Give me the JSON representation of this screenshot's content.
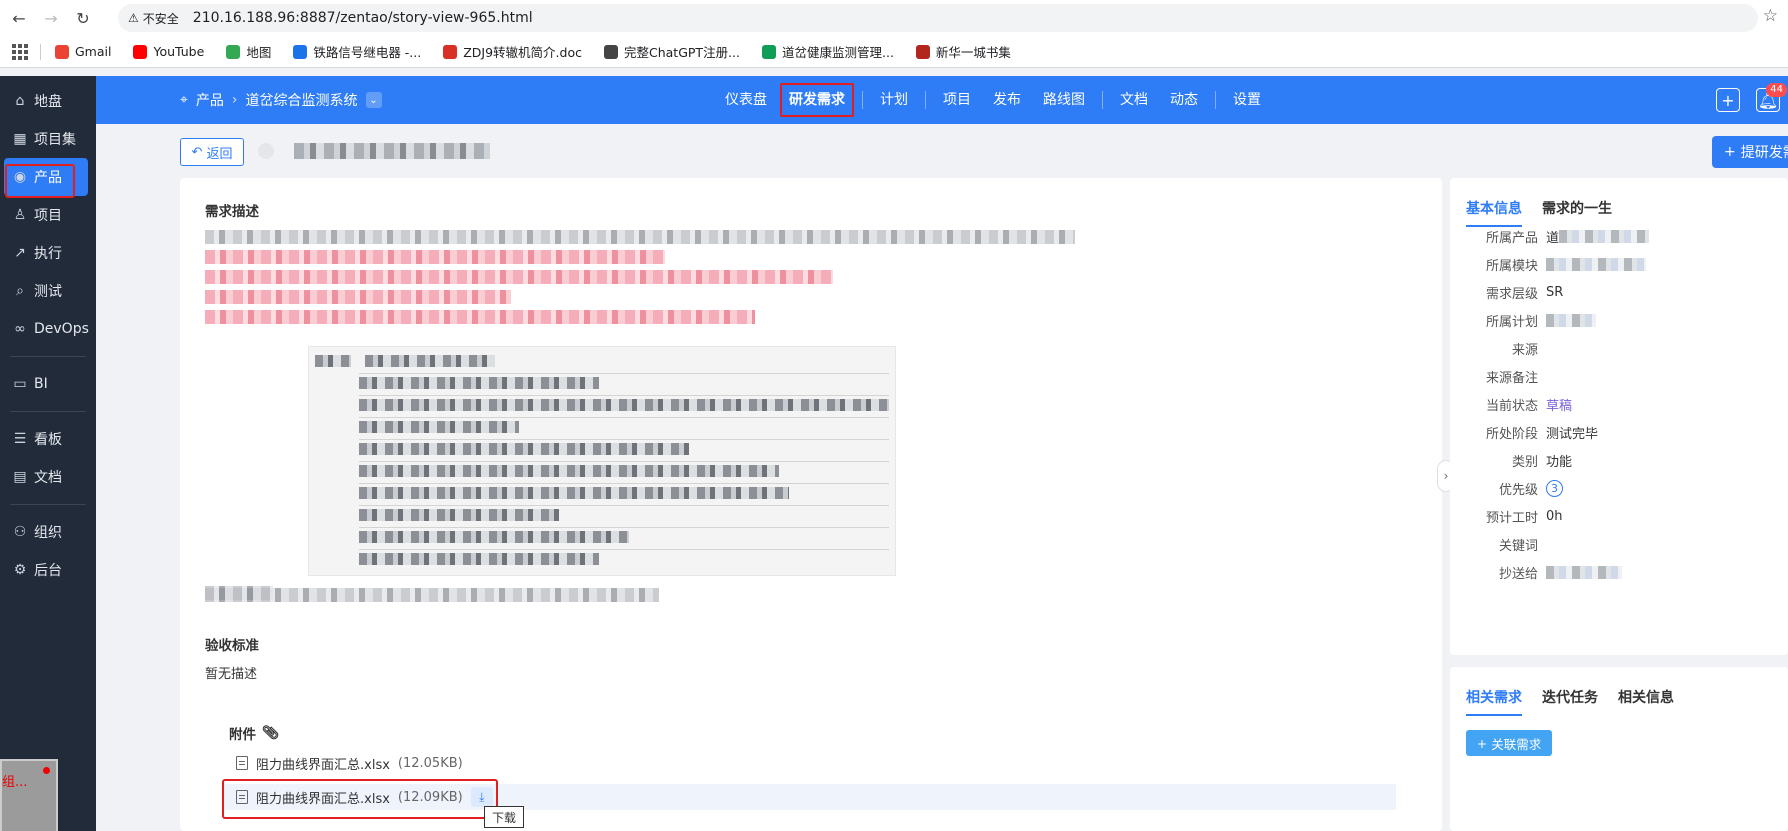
{
  "browser": {
    "insecure_label": "不安全",
    "url": "210.16.188.96:8887/zentao/story-view-965.html",
    "bookmarks": [
      {
        "label": "Gmail",
        "color": "#ea4335"
      },
      {
        "label": "YouTube",
        "color": "#ff0000"
      },
      {
        "label": "地图",
        "color": "#34a853"
      },
      {
        "label": "铁路信号继电器 -...",
        "color": "#1a73e8"
      },
      {
        "label": "ZDJ9转辙机简介.doc",
        "color": "#d93025"
      },
      {
        "label": "完整ChatGPT注册...",
        "color": "#444444"
      },
      {
        "label": "道岔健康监测管理...",
        "color": "#0f9d58"
      },
      {
        "label": "新华一城书集",
        "color": "#b3261e"
      }
    ]
  },
  "sidebar": {
    "items": [
      {
        "label": "地盘",
        "icon": "home-icon"
      },
      {
        "label": "项目集",
        "icon": "grid-icon"
      },
      {
        "label": "产品",
        "icon": "product-icon"
      },
      {
        "label": "项目",
        "icon": "project-icon"
      },
      {
        "label": "执行",
        "icon": "run-icon"
      },
      {
        "label": "测试",
        "icon": "search-icon"
      },
      {
        "label": "DevOps",
        "icon": "infinity-icon"
      },
      {
        "label": "BI",
        "icon": "bi-icon"
      },
      {
        "label": "看板",
        "icon": "kanban-icon"
      },
      {
        "label": "文档",
        "icon": "doc-icon"
      },
      {
        "label": "组织",
        "icon": "org-icon"
      },
      {
        "label": "后台",
        "icon": "gear-icon"
      }
    ],
    "thumb_label": "组..."
  },
  "header": {
    "crumb_root": "产品",
    "crumb_product": "道岔综合监测系统",
    "nav": [
      "仪表盘",
      "研发需求",
      "计划",
      "项目",
      "发布",
      "路线图",
      "文档",
      "动态",
      "设置"
    ],
    "active_nav": "研发需求",
    "badge": "44"
  },
  "toolbar": {
    "back_label": "返回",
    "new_label": "提研发需"
  },
  "main": {
    "desc_title": "需求描述",
    "accept_title": "验收标准",
    "accept_value": "暂无描述",
    "attach_title": "附件",
    "files": [
      {
        "name": "阻力曲线界面汇总.xlsx",
        "size": "(12.05KB)"
      },
      {
        "name": "阻力曲线界面汇总.xlsx",
        "size": "(12.09KB)"
      }
    ],
    "tooltip": "下载"
  },
  "info": {
    "tabs": [
      "基本信息",
      "需求的一生"
    ],
    "rows": [
      {
        "label": "所属产品",
        "value": "道",
        "blur": true
      },
      {
        "label": "所属模块",
        "value": "",
        "blur": true
      },
      {
        "label": "需求层级",
        "value": "SR",
        "blur": false
      },
      {
        "label": "所属计划",
        "value": "",
        "blur": true
      },
      {
        "label": "来源",
        "value": "",
        "blur": false
      },
      {
        "label": "来源备注",
        "value": "",
        "blur": false
      },
      {
        "label": "当前状态",
        "value": "草稿",
        "blur": false
      },
      {
        "label": "所处阶段",
        "value": "测试完毕",
        "blur": false
      },
      {
        "label": "类别",
        "value": "功能",
        "blur": false
      },
      {
        "label": "优先级",
        "value": "3",
        "blur": false
      },
      {
        "label": "预计工时",
        "value": "0h",
        "blur": false
      },
      {
        "label": "关键词",
        "value": "",
        "blur": false
      },
      {
        "label": "抄送给",
        "value": "",
        "blur": true
      }
    ]
  },
  "related": {
    "tabs": [
      "相关需求",
      "迭代任务",
      "相关信息"
    ],
    "link_label": "关联需求"
  }
}
